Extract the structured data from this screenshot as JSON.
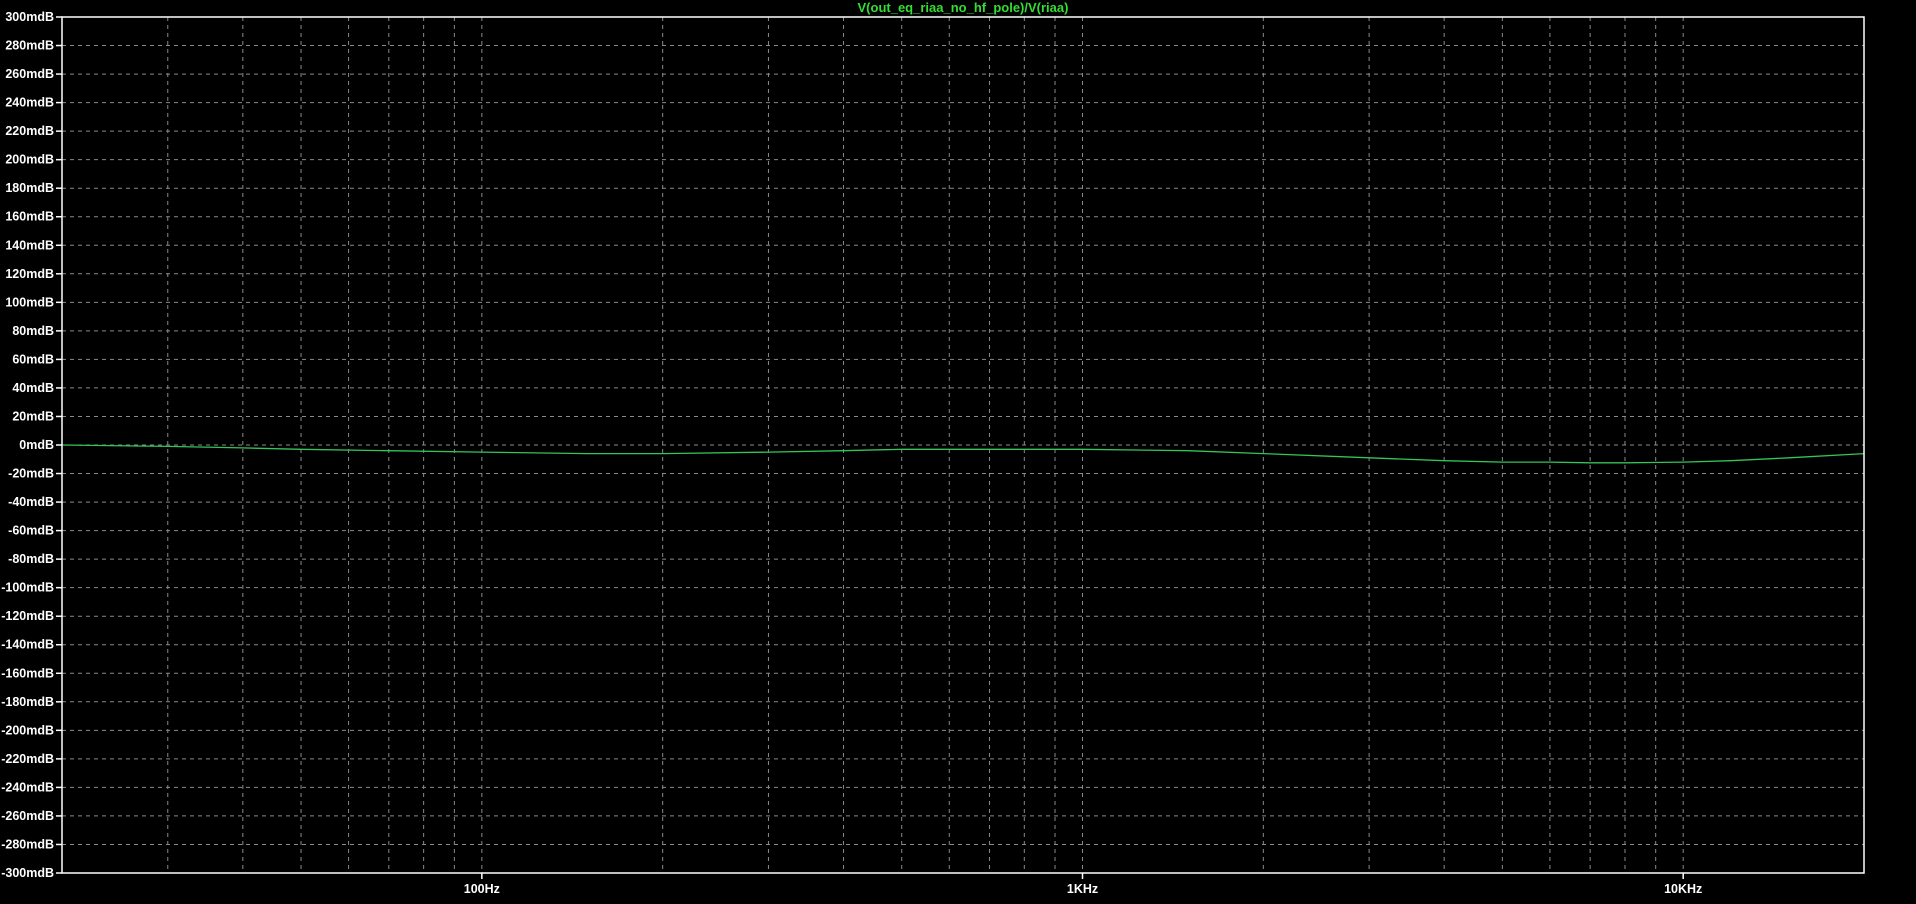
{
  "colors": {
    "background": "#000000",
    "frame": "#ffffff",
    "grid": "#8a8a8a",
    "tick_text": "#ffffff",
    "trace": "#33c45a",
    "title_text": "#33dd33"
  },
  "chart_data": {
    "type": "line",
    "title": "V(out_eq_riaa_no_hf_pole)/V(riaa)",
    "xlabel": "",
    "ylabel": "",
    "x_scale": "log",
    "xlim": [
      20,
      20000
    ],
    "ylim": [
      -300,
      300
    ],
    "y_unit": "dB",
    "grid": true,
    "x_ticks": [
      {
        "value": 100,
        "label": "100Hz"
      },
      {
        "value": 1000,
        "label": "1KHz"
      },
      {
        "value": 10000,
        "label": "10KHz"
      }
    ],
    "y_ticks": [
      {
        "value": 300,
        "label": "300mdB"
      },
      {
        "value": 280,
        "label": "280mdB"
      },
      {
        "value": 260,
        "label": "260mdB"
      },
      {
        "value": 240,
        "label": "240mdB"
      },
      {
        "value": 220,
        "label": "220mdB"
      },
      {
        "value": 200,
        "label": "200mdB"
      },
      {
        "value": 180,
        "label": "180mdB"
      },
      {
        "value": 160,
        "label": "160mdB"
      },
      {
        "value": 140,
        "label": "140mdB"
      },
      {
        "value": 120,
        "label": "120mdB"
      },
      {
        "value": 100,
        "label": "100mdB"
      },
      {
        "value": 80,
        "label": "80mdB"
      },
      {
        "value": 60,
        "label": "60mdB"
      },
      {
        "value": 40,
        "label": "40mdB"
      },
      {
        "value": 20,
        "label": "20mdB"
      },
      {
        "value": 0,
        "label": "0mdB"
      },
      {
        "value": -20,
        "label": "-20mdB"
      },
      {
        "value": -40,
        "label": "-40mdB"
      },
      {
        "value": -60,
        "label": "-60mdB"
      },
      {
        "value": -80,
        "label": "-80mdB"
      },
      {
        "value": -100,
        "label": "-100mdB"
      },
      {
        "value": -120,
        "label": "-120mdB"
      },
      {
        "value": -140,
        "label": "-140mdB"
      },
      {
        "value": -160,
        "label": "-160mdB"
      },
      {
        "value": -180,
        "label": "-180mdB"
      },
      {
        "value": -200,
        "label": "-200mdB"
      },
      {
        "value": -220,
        "label": "-220mdB"
      },
      {
        "value": -240,
        "label": "-240mdB"
      },
      {
        "value": -260,
        "label": "-260mdB"
      },
      {
        "value": -280,
        "label": "-280mdB"
      },
      {
        "value": -300,
        "label": "-300mdB"
      }
    ],
    "series": [
      {
        "x": [
          20,
          30,
          40,
          50,
          70,
          100,
          150,
          200,
          300,
          400,
          500,
          700,
          1000,
          1500,
          2000,
          3000,
          4000,
          5000,
          6000,
          7000,
          8000,
          10000,
          12000,
          15000,
          20000
        ],
        "y": [
          0,
          -1,
          -2,
          -3,
          -4,
          -5,
          -6,
          -6,
          -5,
          -4,
          -3,
          -3,
          -3,
          -4,
          -6,
          -9,
          -11,
          -12,
          -12,
          -12.5,
          -12.5,
          -12,
          -11,
          -9,
          -6
        ]
      }
    ]
  }
}
